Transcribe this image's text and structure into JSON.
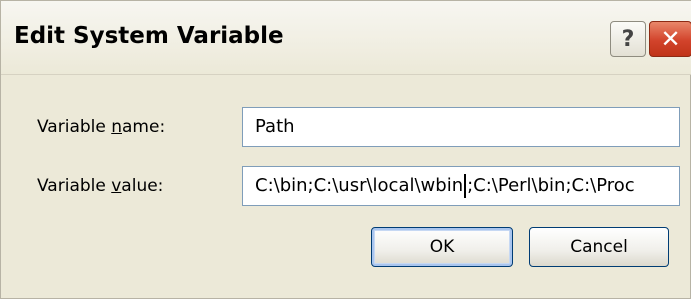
{
  "window": {
    "title": "Edit System Variable",
    "help_symbol": "?",
    "close_symbol": "✕"
  },
  "form": {
    "name_label_pre": "Variable ",
    "name_label_accel": "n",
    "name_label_post": "ame:",
    "name_value": "Path",
    "value_label_pre": "Variable ",
    "value_label_accel": "v",
    "value_label_post": "alue:",
    "value_before_caret": "C:\\bin;C:\\usr\\local\\wbin",
    "value_after_caret": ";C:\\Perl\\bin;C:\\Proc"
  },
  "buttons": {
    "ok_label": "OK",
    "cancel_label": "Cancel"
  }
}
